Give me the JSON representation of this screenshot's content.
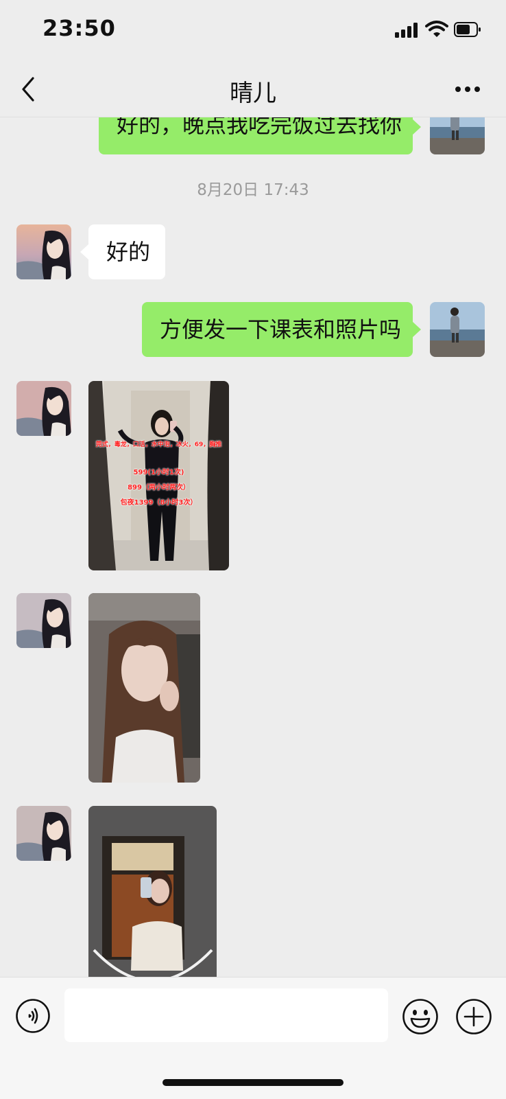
{
  "status_bar": {
    "time": "23:50"
  },
  "header": {
    "title": "晴儿"
  },
  "messages": [
    {
      "sender": "me",
      "type": "text",
      "text": "好的，晚点我吃完饭过去找你"
    },
    {
      "type": "timestamp",
      "text": "8月20日 17:43"
    },
    {
      "sender": "them",
      "type": "text",
      "text": "好的"
    },
    {
      "sender": "me",
      "type": "text",
      "text": "方便发一下课表和照片吗"
    },
    {
      "sender": "them",
      "type": "image",
      "overlay": [
        "莞式，毒龙，口活，水中泡，冰火，69，胸推",
        "599(1小时1次)",
        "899（两小时两次）",
        "包夜1399（8小时3次）"
      ]
    },
    {
      "sender": "them",
      "type": "image"
    },
    {
      "sender": "them",
      "type": "image"
    }
  ],
  "input": {
    "placeholder": ""
  },
  "colors": {
    "my_bubble": "#95ec69",
    "their_bubble": "#ffffff",
    "background": "#ededed"
  }
}
